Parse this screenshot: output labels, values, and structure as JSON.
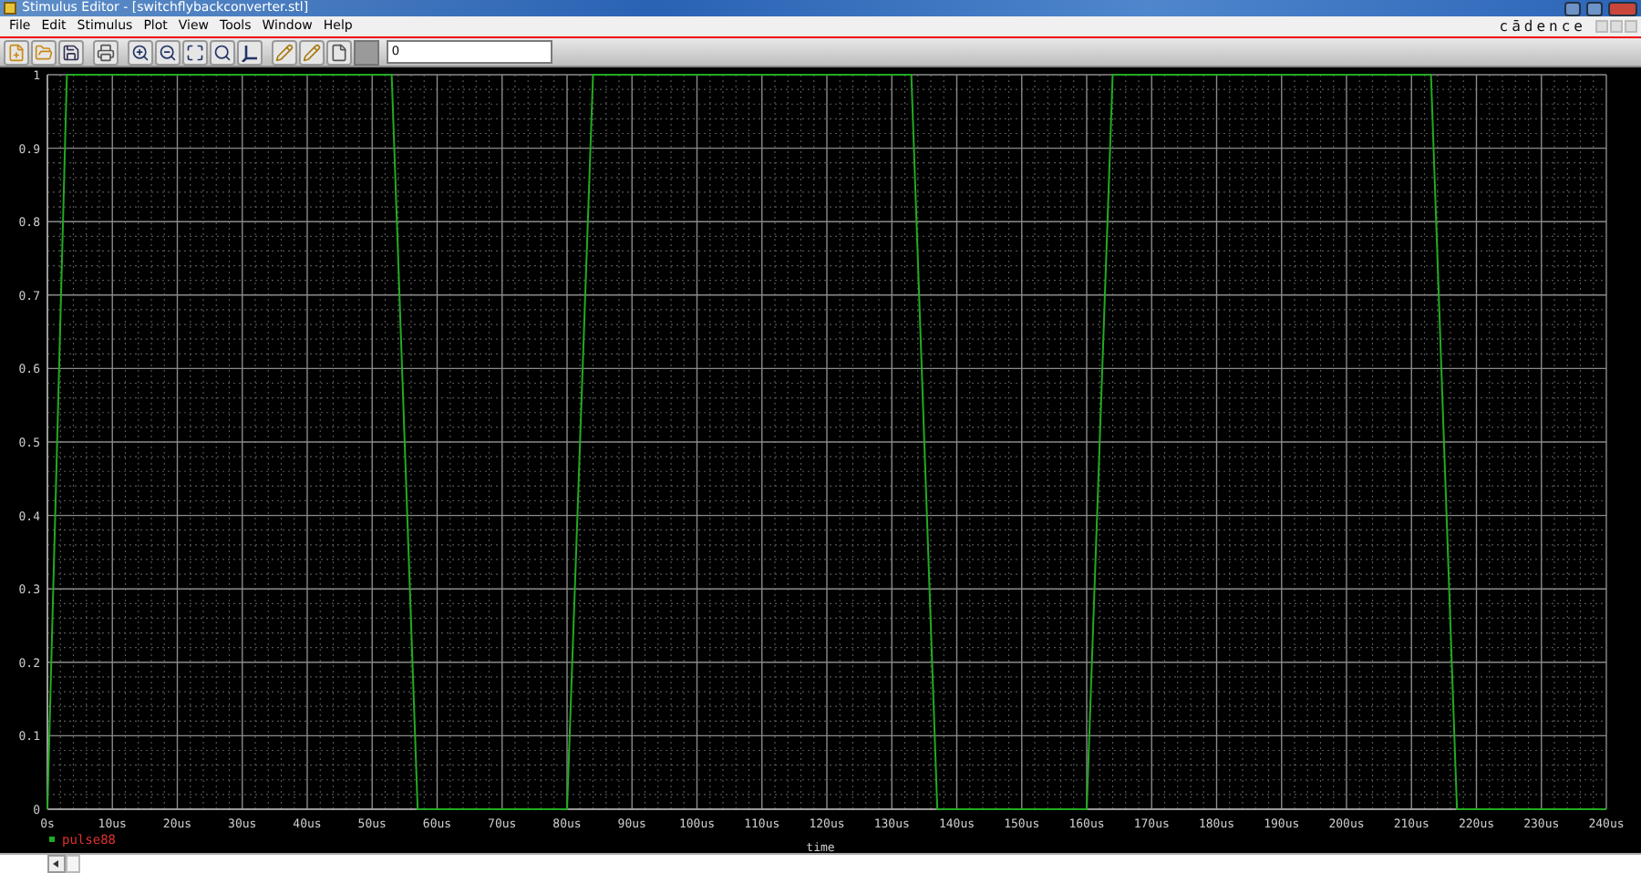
{
  "window": {
    "title": "Stimulus Editor - [switchflybackconverter.stl]"
  },
  "menu": [
    "File",
    "Edit",
    "Stimulus",
    "Plot",
    "View",
    "Tools",
    "Window",
    "Help"
  ],
  "logo": "cādence",
  "toolbar": [
    {
      "kind": "new"
    },
    {
      "kind": "open"
    },
    {
      "kind": "save"
    },
    {
      "kind": "separator"
    },
    {
      "kind": "print"
    },
    {
      "kind": "separator"
    },
    {
      "kind": "zoom-in"
    },
    {
      "kind": "zoom-out"
    },
    {
      "kind": "zoom-fit"
    },
    {
      "kind": "zoom-area"
    },
    {
      "kind": "axis"
    },
    {
      "kind": "separator"
    },
    {
      "kind": "pencil"
    },
    {
      "kind": "pencil"
    },
    {
      "kind": "add"
    },
    {
      "kind": "swatch"
    }
  ],
  "toolbar_field": {
    "value": "0"
  },
  "plot": {
    "chart_data": {
      "type": "line",
      "grid": true,
      "xlabel": "time",
      "xlim": [
        0,
        240
      ],
      "ylim": [
        0,
        1
      ],
      "x": [
        0,
        3,
        53,
        57,
        80,
        84,
        133,
        137,
        160,
        164,
        213,
        217,
        240
      ],
      "series": [
        {
          "name": "pulse88",
          "color": "#22aa22",
          "values": [
            0,
            1,
            1,
            0,
            0,
            1,
            1,
            0,
            0,
            1,
            1,
            0,
            0
          ]
        }
      ],
      "xticks": [
        {
          "value": 0,
          "label": "0s"
        },
        {
          "value": 10,
          "label": "10us"
        },
        {
          "value": 20,
          "label": "20us"
        },
        {
          "value": 30,
          "label": "30us"
        },
        {
          "value": 40,
          "label": "40us"
        },
        {
          "value": 50,
          "label": "50us"
        },
        {
          "value": 60,
          "label": "60us"
        },
        {
          "value": 70,
          "label": "70us"
        },
        {
          "value": 80,
          "label": "80us"
        },
        {
          "value": 90,
          "label": "90us"
        },
        {
          "value": 100,
          "label": "100us"
        },
        {
          "value": 110,
          "label": "110us"
        },
        {
          "value": 120,
          "label": "120us"
        },
        {
          "value": 130,
          "label": "130us"
        },
        {
          "value": 140,
          "label": "140us"
        },
        {
          "value": 150,
          "label": "150us"
        },
        {
          "value": 160,
          "label": "160us"
        },
        {
          "value": 170,
          "label": "170us"
        },
        {
          "value": 180,
          "label": "180us"
        },
        {
          "value": 190,
          "label": "190us"
        },
        {
          "value": 200,
          "label": "200us"
        },
        {
          "value": 210,
          "label": "210us"
        },
        {
          "value": 220,
          "label": "220us"
        },
        {
          "value": 230,
          "label": "230us"
        },
        {
          "value": 240,
          "label": "240us"
        }
      ],
      "yticks": [
        0,
        0.1,
        0.2,
        0.3,
        0.4,
        0.5,
        0.6,
        0.7,
        0.8,
        0.9,
        1
      ]
    }
  }
}
